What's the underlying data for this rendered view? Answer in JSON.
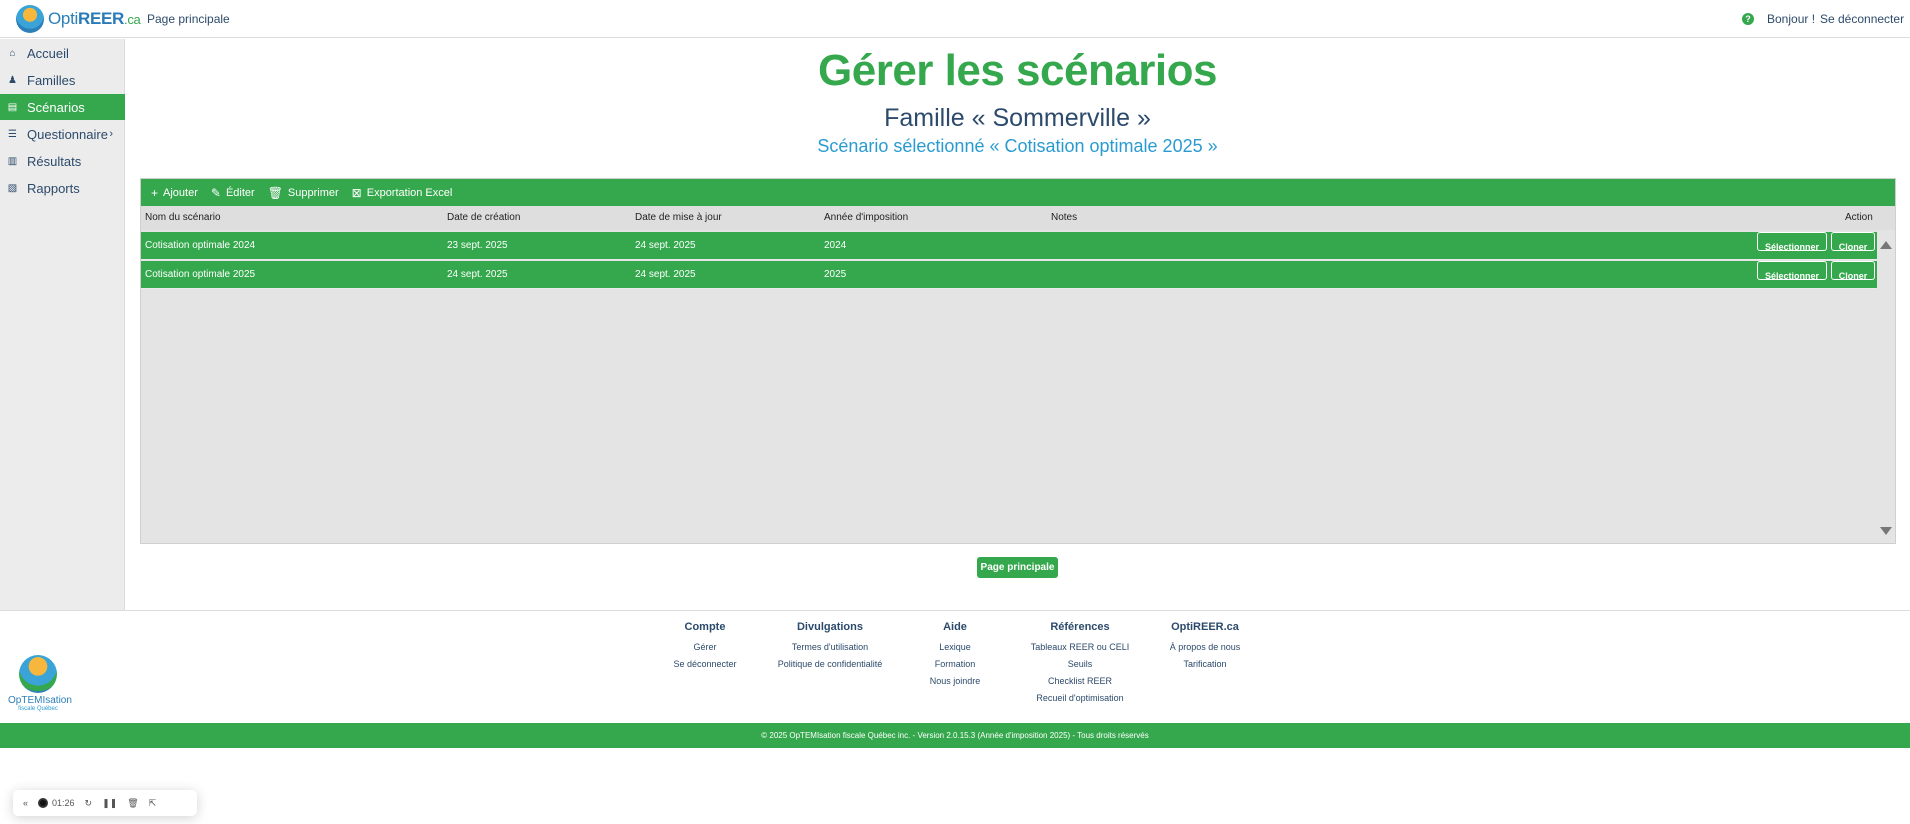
{
  "topbar": {
    "logo_name": "Opti",
    "logo_reer": "REER",
    "logo_ca": ".ca",
    "home_link": "Page principale",
    "help_icon": "?",
    "greeting": "Bonjour !",
    "logout": "Se déconnecter"
  },
  "sidebar": {
    "items": [
      {
        "label": "Accueil",
        "icon": "home-icon",
        "glyph": "⌂"
      },
      {
        "label": "Familles",
        "icon": "family-icon",
        "glyph": "👪"
      },
      {
        "label": "Scénarios",
        "icon": "scenario-icon",
        "glyph": "▤",
        "active": true
      },
      {
        "label": "Questionnaire",
        "icon": "questionnaire-icon",
        "glyph": "☰",
        "chevron": "›"
      },
      {
        "label": "Résultats",
        "icon": "chart-icon",
        "glyph": "▥"
      },
      {
        "label": "Rapports",
        "icon": "report-icon",
        "glyph": "▧"
      }
    ]
  },
  "main": {
    "title": "Gérer les scénarios",
    "family": "Famille « Sommerville »",
    "selected": "Scénario sélectionné « Cotisation optimale 2025 »"
  },
  "toolbar": {
    "add": "Ajouter",
    "edit": "Éditer",
    "delete": "Supprimer",
    "export": "Exportation Excel"
  },
  "table": {
    "headers": [
      "Nom du scénario",
      "Date de création",
      "Date de mise à jour",
      "Année d'imposition",
      "Notes",
      "Action"
    ],
    "rows": [
      [
        "Cotisation optimale 2024",
        "23 sept. 2025",
        "24 sept. 2025",
        "2024",
        ""
      ],
      [
        "Cotisation optimale 2025",
        "24 sept. 2025",
        "24 sept. 2025",
        "2025",
        ""
      ]
    ],
    "select_label": "Sélectionner",
    "clone_label": "Cloner"
  },
  "main_button": "Page principale",
  "footer": {
    "logo_text": "OpTEMIsation",
    "logo_sub": "fiscale Québec",
    "columns": [
      {
        "title": "Compte",
        "links": [
          "Gérer",
          "Se déconnecter"
        ]
      },
      {
        "title": "Divulgations",
        "links": [
          "Termes d'utilisation",
          "Politique de confidentialité"
        ]
      },
      {
        "title": "Aide",
        "links": [
          "Lexique",
          "Formation",
          "Nous joindre"
        ]
      },
      {
        "title": "Références",
        "links": [
          "Tableaux REER ou CELI",
          "Seuils",
          "Checklist REER",
          "Recueil d'optimisation"
        ]
      },
      {
        "title": "OptiREER.ca",
        "links": [
          "À propos de nous",
          "Tarification"
        ]
      }
    ],
    "copyright": "© 2025 OpTEMIsation fiscale Québec inc. - Version 2.0.15.3 (Année d'imposition 2025) - Tous droits réservés"
  },
  "recorder": {
    "collapse": "«",
    "time": "01:26"
  },
  "colors": {
    "accent_green": "#35a84d",
    "navy": "#2c4a6b",
    "light_blue": "#2a9bd1"
  }
}
